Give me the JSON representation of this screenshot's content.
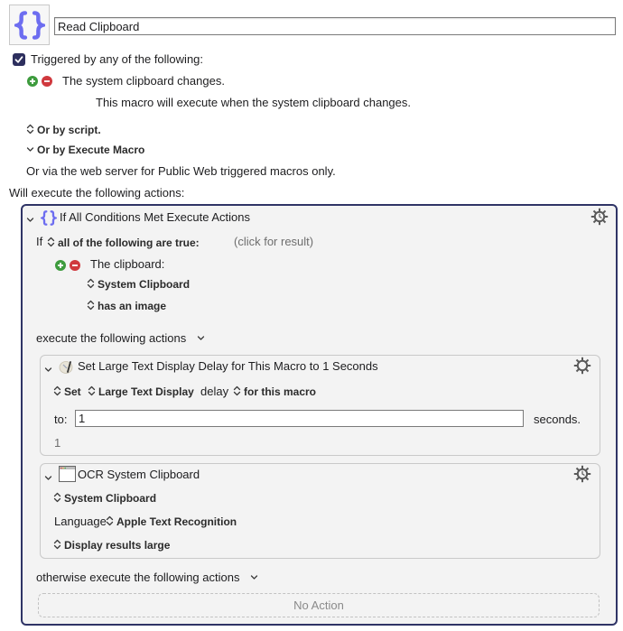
{
  "macro": {
    "icon": "curly-braces-icon",
    "name": "Read Clipboard"
  },
  "triggers": {
    "enabled": true,
    "header": "Triggered by any of the following:",
    "items": [
      {
        "label": "The system clipboard changes.",
        "description": "This macro will execute when the system clipboard changes."
      }
    ],
    "by_script": "Or by script.",
    "by_execute_macro": "Or by Execute Macro",
    "web_server": "Or via the web server for Public Web triggered macros only."
  },
  "actions_header": "Will execute the following actions:",
  "if_action": {
    "title": "If All Conditions Met Execute Actions",
    "icon": "curly-braces-icon",
    "if_label": "If",
    "condition_mode": "all of the following are true:",
    "click_for_result": "(click for result)",
    "condition": {
      "label": "The clipboard:",
      "source": "System Clipboard",
      "test": "has an image"
    },
    "then_label": "execute the following actions",
    "else_label": "otherwise execute the following actions",
    "else_empty": "No Action",
    "actions": [
      {
        "title": "Set Large Text Display Delay for This Macro to 1 Seconds",
        "icon": "large-text-delay-icon",
        "set": "Set",
        "target": "Large Text Display",
        "delay_word": "delay",
        "scope": "for this macro",
        "to_label": "to:",
        "value": "1",
        "unit": "seconds.",
        "result": "1"
      },
      {
        "title": "OCR System Clipboard",
        "icon": "window-icon",
        "source": "System Clipboard",
        "language_label": "Language",
        "language": "Apple Text Recognition",
        "output": "Display results large"
      }
    ]
  },
  "colors": {
    "accent_border": "#2f3466",
    "icon_blue": "#6d6df0",
    "plus_green": "#3d9b3d",
    "minus_red": "#d0393e"
  }
}
